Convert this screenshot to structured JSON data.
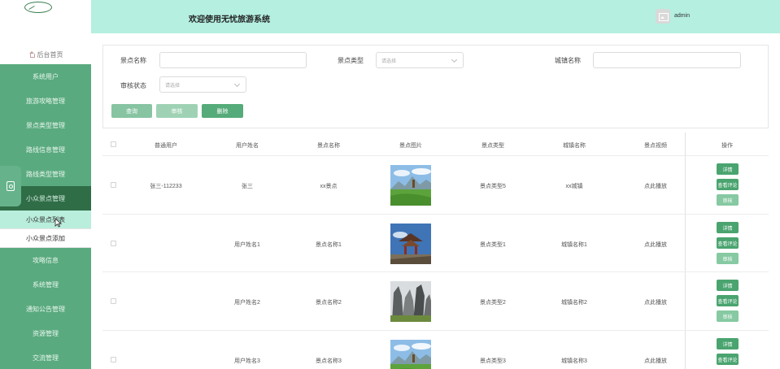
{
  "header": {
    "title": "欢迎使用无忧旅游系统",
    "user": "admin"
  },
  "sidebar": {
    "home": "后台首页",
    "items": [
      {
        "label": "系统用户"
      },
      {
        "label": "旅游攻略管理"
      },
      {
        "label": "景点类型管理"
      },
      {
        "label": "路线信息管理"
      },
      {
        "label": "路线类型管理"
      },
      {
        "label": "小众景点管理",
        "active": true
      }
    ],
    "subitems": [
      {
        "label": "小众景点列表",
        "selected": true
      },
      {
        "label": "小众景点添加"
      }
    ],
    "items_after": [
      {
        "label": "攻略信息"
      },
      {
        "label": "系统管理"
      },
      {
        "label": "通知公告管理"
      },
      {
        "label": "资源管理"
      },
      {
        "label": "交流管理"
      }
    ]
  },
  "search": {
    "scenic_name_label": "景点名称",
    "scenic_name_value": "",
    "scenic_type_label": "景点类型",
    "scenic_type_placeholder": "请选择",
    "city_name_label": "城镇名称",
    "city_name_value": "",
    "audit_status_label": "审核状态",
    "audit_status_placeholder": "请选择",
    "query_label": "查询",
    "audit_label": "审核",
    "delete_label": "删除"
  },
  "colors": {
    "sidebar": "#5aaa7f",
    "header": "#b4efe0",
    "query_button": "#87c4a2",
    "audit_button": "#9fd2b5",
    "delete_button": "#55ab79"
  },
  "table": {
    "columns": [
      "普通用户",
      "用户姓名",
      "景点名称",
      "景点图片",
      "景点类型",
      "城镇名称",
      "景点视频",
      "操作"
    ],
    "rows": [
      {
        "user": "张三-112233",
        "user_name": "张三",
        "scenic_name": "xx景点",
        "image": "grassland-icon",
        "type": "景点类型5",
        "city": "xx城镇",
        "video": "点此播放"
      },
      {
        "user": "",
        "user_name": "用户姓名1",
        "scenic_name": "景点名称1",
        "image": "pavilion-icon",
        "type": "景点类型1",
        "city": "城镇名称1",
        "video": "点此播放"
      },
      {
        "user": "",
        "user_name": "用户姓名2",
        "scenic_name": "景点名称2",
        "image": "stone-forest-icon",
        "type": "景点类型2",
        "city": "城镇名称2",
        "video": "点此播放"
      },
      {
        "user": "",
        "user_name": "用户姓名3",
        "scenic_name": "景点名称3",
        "image": "grassland-icon",
        "type": "景点类型3",
        "city": "城镇名称3",
        "video": "点此播放"
      }
    ],
    "actions": {
      "detail": "详情",
      "review": "查看评论",
      "audit": "审核"
    }
  }
}
